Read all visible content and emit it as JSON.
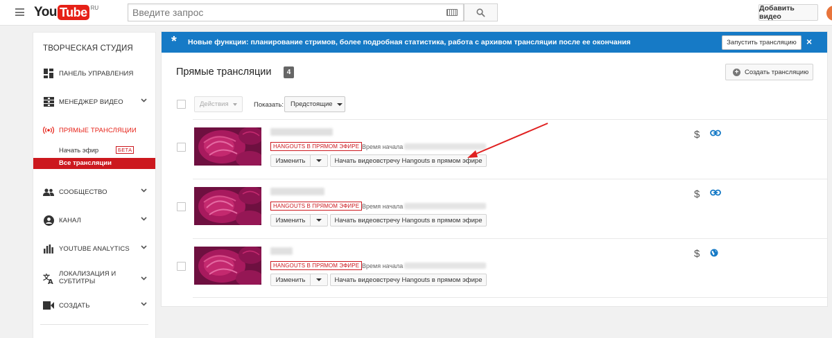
{
  "header": {
    "logo_you": "You",
    "logo_tube": "Tube",
    "logo_region": "RU",
    "search_placeholder": "Введите запрос",
    "upload_label": "Добавить видео"
  },
  "sidebar": {
    "title": "ТВОРЧЕСКАЯ СТУДИЯ",
    "items": [
      {
        "label": "ПАНЕЛЬ УПРАВЛЕНИЯ",
        "icon": "dashboard-icon"
      },
      {
        "label": "МЕНЕДЖЕР ВИДЕО",
        "icon": "video-manager-icon",
        "expandable": true
      },
      {
        "label": "ПРЯМЫЕ ТРАНСЛЯЦИИ",
        "icon": "live-broadcast-icon",
        "active": true
      },
      {
        "label": "СООБЩЕСТВО",
        "icon": "community-icon",
        "expandable": true
      },
      {
        "label": "КАНАЛ",
        "icon": "channel-icon",
        "expandable": true
      },
      {
        "label": "YOUTUBE ANALYTICS",
        "icon": "analytics-icon",
        "expandable": true
      },
      {
        "label_line1": "ЛОКАЛИЗАЦИЯ И",
        "label_line2": "СУБТИТРЫ",
        "icon": "translate-icon",
        "expandable": true
      },
      {
        "label": "СОЗДАТЬ",
        "icon": "create-video-icon",
        "expandable": true
      }
    ],
    "live_sub": {
      "go_live": "Начать эфир",
      "beta": "БЕТА",
      "all_broadcasts": "Все трансляции"
    }
  },
  "banner": {
    "message": "Новые функции: планирование стримов, более подробная статистика, работа с архивом трансляции после ее окончания",
    "start_button": "Запустить трансляцию",
    "close": "×",
    "color": "#167ac6"
  },
  "main": {
    "heading": "Прямые трансляции",
    "count": "4",
    "create_button": "Создать трансляцию",
    "actions_label": "Действия",
    "show_label": "Показать:",
    "filter_value": "Предстоящие"
  },
  "rows": [
    {
      "badge": "HANGOUTS В ПРЯМОМ ЭФИРЕ",
      "start_label": "Время начала",
      "edit": "Изменить",
      "hangout": "Начать видеовстречу Hangouts в прямом эфире",
      "monetization": "$",
      "status_icon": "link-icon"
    },
    {
      "badge": "HANGOUTS В ПРЯМОМ ЭФИРЕ",
      "start_label": "Время начала",
      "edit": "Изменить",
      "hangout": "Начать видеовстречу Hangouts в прямом эфире",
      "monetization": "$",
      "status_icon": "link-icon"
    },
    {
      "badge": "HANGOUTS В ПРЯМОМ ЭФИРЕ",
      "start_label": "Время начала",
      "edit": "Изменить",
      "hangout": "Начать видеовстречу Hangouts в прямом эфире",
      "monetization": "$",
      "status_icon": "globe-icon"
    }
  ],
  "colors": {
    "accent_red": "#cc181e",
    "brand_red": "#e62117",
    "link_blue": "#167ac6",
    "annotation_arrow": "#e02020"
  }
}
